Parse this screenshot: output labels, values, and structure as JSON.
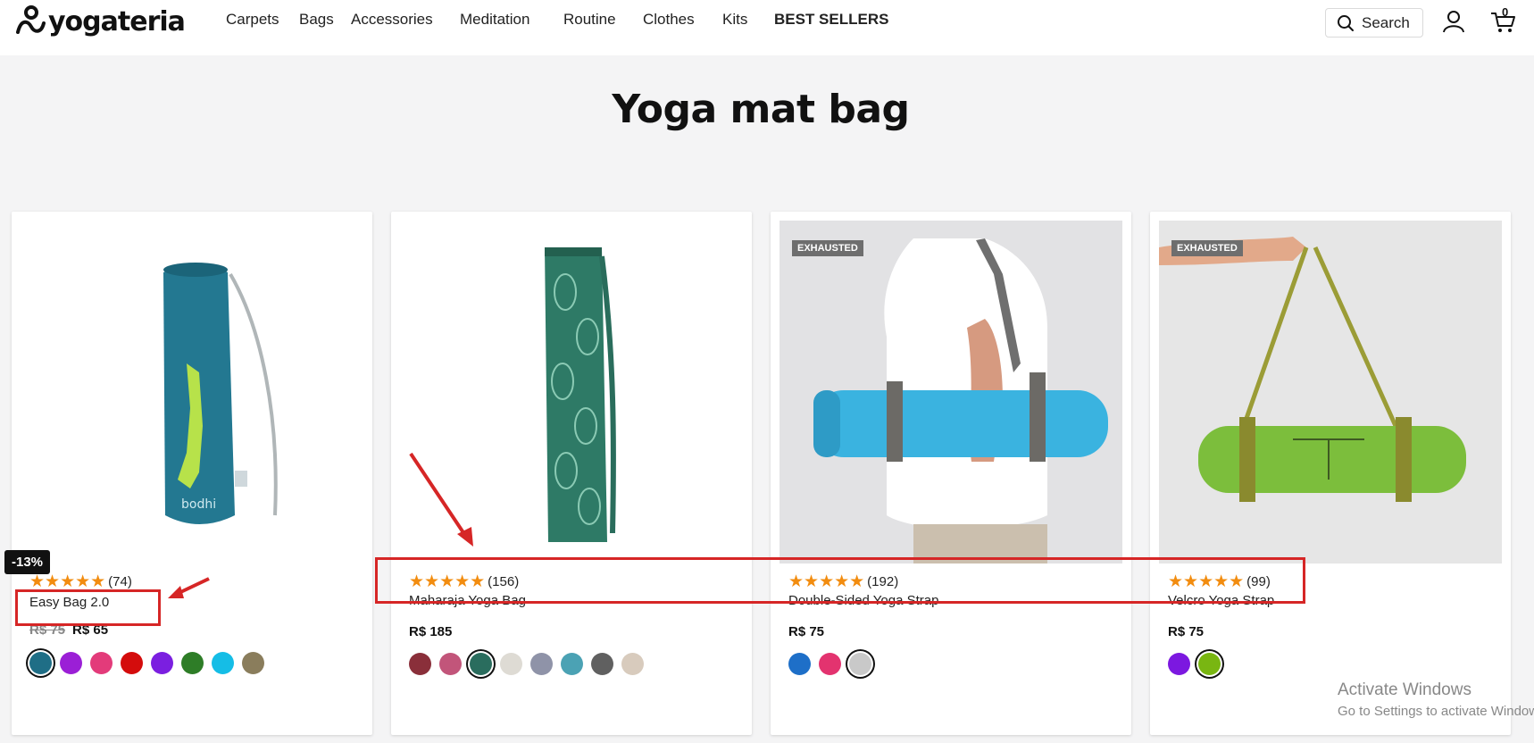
{
  "brand": {
    "name": "yogateria"
  },
  "nav": {
    "items": [
      {
        "label": "Carpets"
      },
      {
        "label": "Bags"
      },
      {
        "label": "Accessories"
      },
      {
        "label": "Meditation"
      },
      {
        "label": "Routine"
      },
      {
        "label": "Clothes"
      },
      {
        "label": "Kits"
      },
      {
        "label": "BEST SELLERS"
      }
    ]
  },
  "header": {
    "search_label": "Search",
    "cart_count": "0"
  },
  "page": {
    "title": "Yoga mat bag"
  },
  "products": [
    {
      "name": "Easy Bag 2.0",
      "reviews": "(74)",
      "rating_stars": 5,
      "old_price": "R$ 75",
      "price": "R$ 65",
      "discount": "-13%",
      "swatches": [
        "#1f6e86",
        "#9b1fd6",
        "#e33b7a",
        "#d40c0c",
        "#7b1fe0",
        "#2e7d27",
        "#15bde6",
        "#8a7d5c"
      ],
      "selected": 0
    },
    {
      "name": "Maharaja Yoga Bag",
      "reviews": "(156)",
      "rating_stars": 5,
      "price": "R$ 185",
      "swatches": [
        "#8a2f3a",
        "#c2557a",
        "#2a6d5e",
        "#dedbd4",
        "#8f93a8",
        "#4ba2b4",
        "#606060",
        "#d8cbbd"
      ],
      "selected": 2
    },
    {
      "name": "Double-Sided Yoga Strap",
      "reviews": "(192)",
      "rating_stars": 5,
      "price": "R$ 75",
      "badge": "EXHAUSTED",
      "swatches": [
        "#1e6fc8",
        "#e3336f",
        "#c9c9c9"
      ],
      "selected": 2
    },
    {
      "name": "Velcro Yoga Strap",
      "reviews": "(99)",
      "rating_stars": 5,
      "price": "R$ 75",
      "badge": "EXHAUSTED",
      "swatches": [
        "#7c18e0",
        "#79b612"
      ],
      "selected": 1
    }
  ],
  "watermark": {
    "line1": "Activate Windows",
    "line2": "Go to Settings to activate Windows."
  },
  "colors": {
    "annotation": "#d62626",
    "star": "#f28c0f"
  }
}
